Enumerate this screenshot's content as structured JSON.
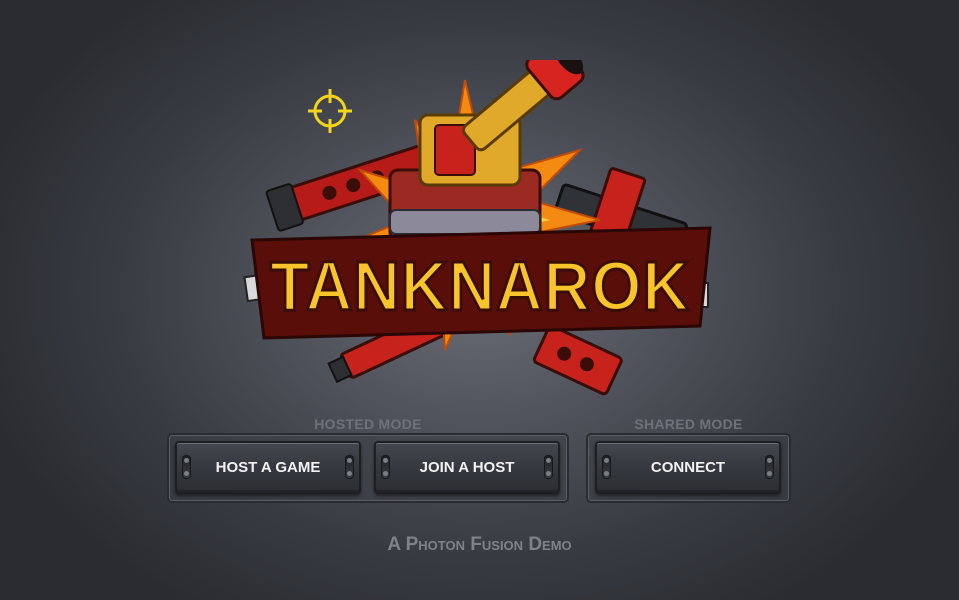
{
  "game": {
    "title": "TANKNAROK"
  },
  "menu": {
    "hosted_mode": {
      "label": "HOSTED MODE",
      "buttons": [
        "HOST A GAME",
        "JOIN A HOST"
      ]
    },
    "shared_mode": {
      "label": "SHARED MODE",
      "buttons": [
        "CONNECT"
      ]
    }
  },
  "footer": "A Photon Fusion Demo",
  "colors": {
    "crosshair": "#f3d51c",
    "title_fill": "#f7c42a",
    "title_outline": "#3a0d08",
    "tank_red": "#d8241f",
    "explosion_orange": "#f58a12",
    "button_text": "#f2f2f2",
    "label_gray": "#6e717a"
  },
  "icons": {
    "cursor": "crosshair-icon",
    "logo_art": "tank-cannon-explosion-icon"
  }
}
